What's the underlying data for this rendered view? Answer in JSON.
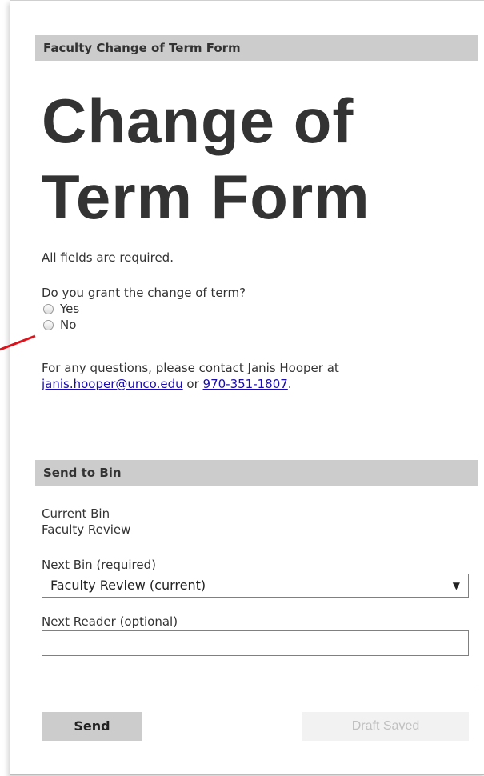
{
  "form_header": "Faculty Change of Term Form",
  "title_line1": "Change of",
  "title_line2": "Term Form",
  "required_note": "All fields are required.",
  "question": "Do you grant the change of term?",
  "options": [
    "Yes",
    "No"
  ],
  "contact": {
    "prefix": "For any questions, please contact Janis Hooper at",
    "email": "janis.hooper@unco.edu",
    "or_text": "or",
    "phone": "970-351-1807",
    "suffix": "."
  },
  "send_to_bin": {
    "header": "Send to Bin",
    "current_bin_label": "Current Bin",
    "current_bin_value": "Faculty Review",
    "next_bin_label": "Next Bin (required)",
    "next_bin_selected": "Faculty Review (current)",
    "next_reader_label": "Next Reader (optional)",
    "next_reader_value": ""
  },
  "buttons": {
    "send": "Send",
    "draft_saved": "Draft Saved"
  },
  "colors": {
    "header_bg": "#cccccc",
    "link": "#1a0dab",
    "annotation_arrow": "#d9141c"
  },
  "icons": {
    "radio": "radio-button-icon",
    "dropdown": "dropdown-arrow-icon"
  }
}
